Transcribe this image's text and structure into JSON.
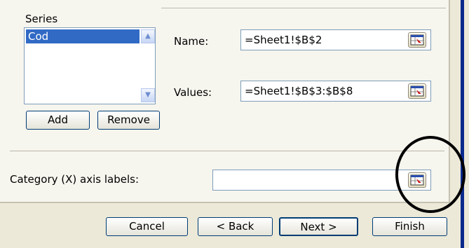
{
  "series": {
    "label": "Series",
    "items": [
      "Cod"
    ]
  },
  "fields": {
    "name_label": "Name:",
    "name_value": "=Sheet1!$B$2",
    "values_label": "Values:",
    "values_value": "=Sheet1!$B$3:$B$8",
    "category_label": "Category (X) axis labels:",
    "category_value": ""
  },
  "buttons": {
    "add": "Add",
    "remove": "Remove",
    "cancel": "Cancel",
    "back": "< Back",
    "next": "Next >",
    "finish": "Finish"
  }
}
